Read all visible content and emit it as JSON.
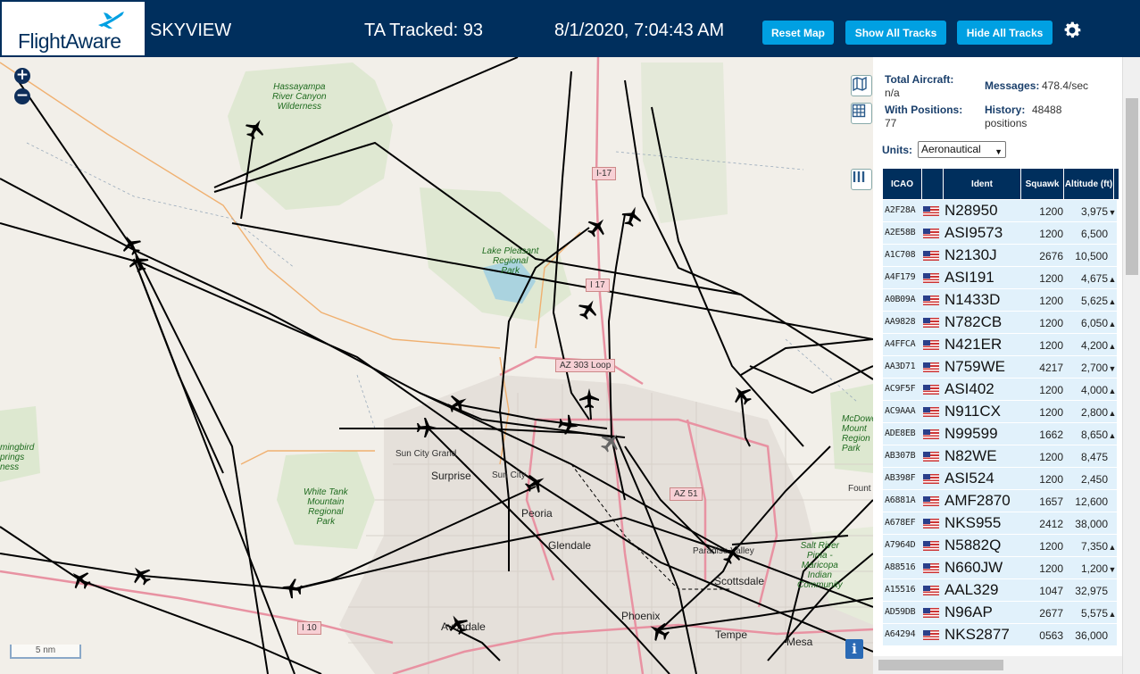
{
  "header": {
    "logo": "FlightAware",
    "app_name": "SKYVIEW",
    "tracked": "TA Tracked: 93",
    "clock": "8/1/2020, 7:04:43 AM",
    "buttons": {
      "reset": "Reset Map",
      "show_all": "Show All Tracks",
      "hide_all": "Hide All Tracks"
    },
    "settings_icon": "gear-icon"
  },
  "map": {
    "zoom_in": "+",
    "zoom_out": "−",
    "scale": "5 nm",
    "info": "i",
    "labels": {
      "hassayampa": "Hassayampa\nRiver Canyon\nWilderness",
      "lake_pleasant": "Lake Pleasant\nRegional\nPark",
      "white_tank": "White Tank\nMountain\nRegional\nPark",
      "hummingbird": "mingbird\nprings\nness",
      "mcdowell": "McDowe\nMount\nRegion\nPark",
      "salt_river": "Salt River\nPima -\nMaricopa\nIndian\nCommunity",
      "sun_city_grand": "Sun City Grand",
      "surprise": "Surprise",
      "sun_city": "Sun City",
      "peoria": "Peoria",
      "glendale": "Glendale",
      "paradise_valley": "Paradise Valley",
      "scottsdale": "Scottsdale",
      "phoenix": "Phoenix",
      "avondale": "Avondale",
      "tempe": "Tempe",
      "mesa": "Mesa",
      "fount": "Fount"
    },
    "shields": {
      "i17_top": "I-17",
      "i17_mid": "I 17",
      "az303": "AZ 303 Loop",
      "az51": "AZ 51",
      "i10": "I 10"
    }
  },
  "stats": {
    "total_label": "Total Aircraft:",
    "total_value": "n/a",
    "messages_label": "Messages:",
    "messages_value": "478.4/sec",
    "with_positions_label": "With Positions:",
    "with_positions_value": "77",
    "history_label": "History:",
    "history_value": "48488",
    "history_unit": "positions"
  },
  "units": {
    "label": "Units:",
    "selected": "Aeronautical"
  },
  "table": {
    "columns": [
      "ICAO",
      "Ident",
      "Squawk",
      "Altitude (ft)"
    ],
    "rows": [
      {
        "icao": "A2F28A",
        "ident": "N28950",
        "squawk": "1200",
        "alt": "3,975",
        "trend": "▼"
      },
      {
        "icao": "A2E58B",
        "ident": "ASI9573",
        "squawk": "1200",
        "alt": "6,500",
        "trend": ""
      },
      {
        "icao": "A1C708",
        "ident": "N2130J",
        "squawk": "2676",
        "alt": "10,500",
        "trend": ""
      },
      {
        "icao": "A4F179",
        "ident": "ASI191",
        "squawk": "1200",
        "alt": "4,675",
        "trend": "▲"
      },
      {
        "icao": "A0B09A",
        "ident": "N1433D",
        "squawk": "1200",
        "alt": "5,625",
        "trend": "▲"
      },
      {
        "icao": "AA9828",
        "ident": "N782CB",
        "squawk": "1200",
        "alt": "6,050",
        "trend": "▲"
      },
      {
        "icao": "A4FFCA",
        "ident": "N421ER",
        "squawk": "1200",
        "alt": "4,200",
        "trend": "▲"
      },
      {
        "icao": "AA3D71",
        "ident": "N759WE",
        "squawk": "4217",
        "alt": "2,700",
        "trend": "▼"
      },
      {
        "icao": "AC9F5F",
        "ident": "ASI402",
        "squawk": "1200",
        "alt": "4,000",
        "trend": "▲"
      },
      {
        "icao": "AC9AAA",
        "ident": "N911CX",
        "squawk": "1200",
        "alt": "2,800",
        "trend": "▲"
      },
      {
        "icao": "ADE8EB",
        "ident": "N99599",
        "squawk": "1662",
        "alt": "8,650",
        "trend": "▲"
      },
      {
        "icao": "AB307B",
        "ident": "N82WE",
        "squawk": "1200",
        "alt": "8,475",
        "trend": ""
      },
      {
        "icao": "AB398F",
        "ident": "ASI524",
        "squawk": "1200",
        "alt": "2,450",
        "trend": ""
      },
      {
        "icao": "A6881A",
        "ident": "AMF2870",
        "squawk": "1657",
        "alt": "12,600",
        "trend": ""
      },
      {
        "icao": "A678EF",
        "ident": "NKS955",
        "squawk": "2412",
        "alt": "38,000",
        "trend": ""
      },
      {
        "icao": "A7964D",
        "ident": "N5882Q",
        "squawk": "1200",
        "alt": "7,350",
        "trend": "▲"
      },
      {
        "icao": "A88516",
        "ident": "N660JW",
        "squawk": "1200",
        "alt": "1,200",
        "trend": "▼"
      },
      {
        "icao": "A15516",
        "ident": "AAL329",
        "squawk": "1047",
        "alt": "32,975",
        "trend": ""
      },
      {
        "icao": "AD59DB",
        "ident": "N96AP",
        "squawk": "2677",
        "alt": "5,575",
        "trend": "▲"
      },
      {
        "icao": "A64294",
        "ident": "NKS2877",
        "squawk": "0563",
        "alt": "36,000",
        "trend": ""
      }
    ]
  }
}
